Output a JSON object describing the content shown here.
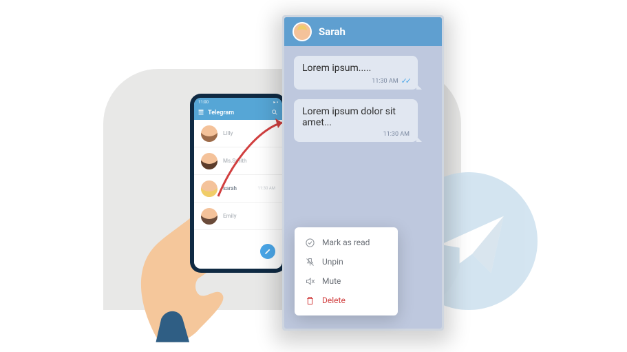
{
  "phone": {
    "status_time": "11:00",
    "app_title": "Telegram",
    "contacts": [
      {
        "name": "Lilly",
        "time": "",
        "hair": "#9c6b4a",
        "skin": "#f4c29a"
      },
      {
        "name": "Ms.Smith",
        "time": "",
        "hair": "#5b3c2a",
        "skin": "#f4c29a"
      },
      {
        "name": "sarah",
        "time": "11:30 AM",
        "hair": "#f0cd68",
        "skin": "#f4c29a"
      },
      {
        "name": "Emily",
        "time": "",
        "hair": "#6a4b3a",
        "skin": "#f4c29a"
      }
    ]
  },
  "chat": {
    "name": "Sarah",
    "avatar_hair": "#f0cd68",
    "messages": [
      {
        "text": "Lorem ipsum.....",
        "time": "11:30 AM",
        "read": true
      },
      {
        "text": "Lorem ipsum dolor sit amet...",
        "time": "11:30 AM",
        "read": false
      }
    ]
  },
  "menu": {
    "mark_as_read": "Mark as read",
    "unpin": "Unpin",
    "mute": "Mute",
    "delete": "Delete"
  }
}
